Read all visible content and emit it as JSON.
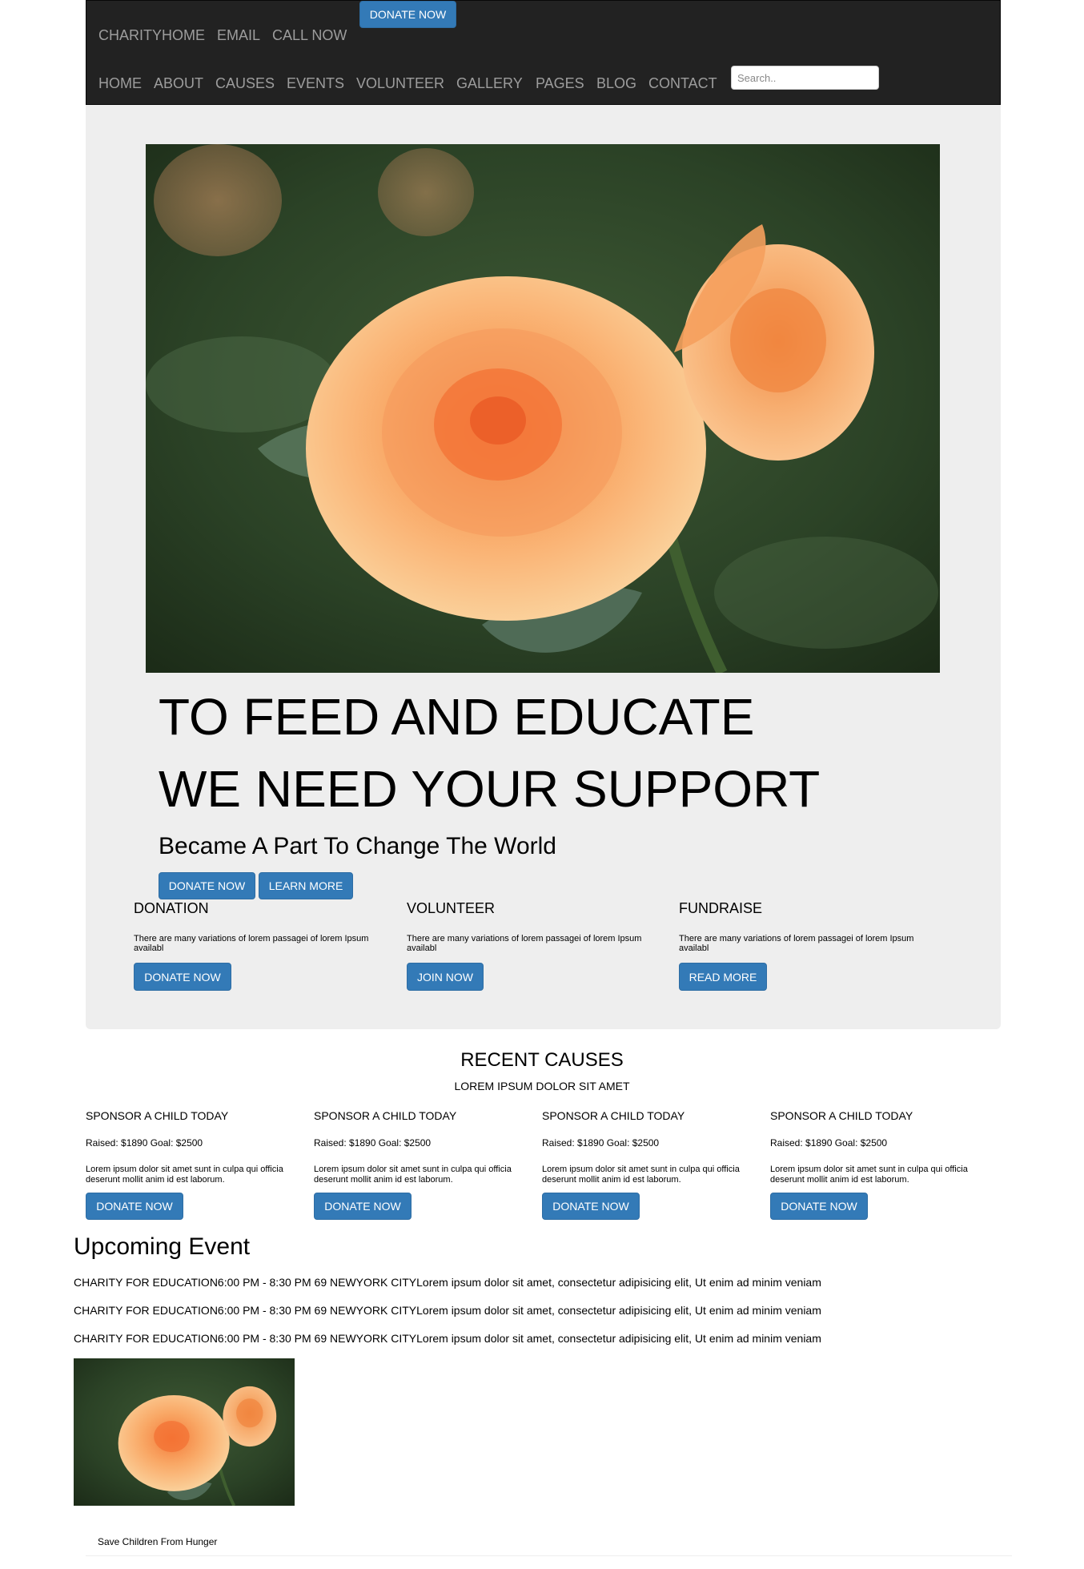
{
  "topbar": {
    "brand": "CHARITYHOME",
    "email": "EMAIL",
    "call": "CALL NOW",
    "donate_label": "DONATE NOW"
  },
  "nav": {
    "items": [
      "HOME",
      "ABOUT",
      "CAUSES",
      "EVENTS",
      "VOLUNTEER",
      "GALLERY",
      "PAGES",
      "BLOG",
      "CONTACT"
    ],
    "search_placeholder": "Search.."
  },
  "hero": {
    "line1": "TO FEED AND EDUCATE",
    "line2": "WE NEED YOUR SUPPORT",
    "subtitle": "Became A Part To Change The World",
    "donate_label": "DONATE NOW",
    "learn_label": "LEARN MORE"
  },
  "features": [
    {
      "title": "DONATION",
      "text": "There are many variations of lorem passagei of lorem Ipsum availabl",
      "button": "DONATE NOW"
    },
    {
      "title": "VOLUNTEER",
      "text": "There are many variations of lorem passagei of lorem Ipsum availabl",
      "button": "JOIN NOW"
    },
    {
      "title": "FUNDRAISE",
      "text": "There are many variations of lorem passagei of lorem Ipsum availabl",
      "button": "READ MORE"
    }
  ],
  "recent_causes": {
    "title": "RECENT CAUSES",
    "subtitle": "LOREM IPSUM DOLOR SIT AMET",
    "items": [
      {
        "title": "SPONSOR A CHILD TODAY",
        "raised": "Raised: $1890 Goal: $2500",
        "text": "Lorem ipsum dolor sit amet sunt in culpa qui officia deserunt mollit anim id est laborum.",
        "button": "DONATE NOW"
      },
      {
        "title": "SPONSOR A CHILD TODAY",
        "raised": "Raised: $1890 Goal: $2500",
        "text": "Lorem ipsum dolor sit amet sunt in culpa qui officia deserunt mollit anim id est laborum.",
        "button": "DONATE NOW"
      },
      {
        "title": "SPONSOR A CHILD TODAY",
        "raised": "Raised: $1890 Goal: $2500",
        "text": "Lorem ipsum dolor sit amet sunt in culpa qui officia deserunt mollit anim id est laborum.",
        "button": "DONATE NOW"
      },
      {
        "title": "SPONSOR A CHILD TODAY",
        "raised": "Raised: $1890 Goal: $2500",
        "text": "Lorem ipsum dolor sit amet sunt in culpa qui officia deserunt mollit anim id est laborum.",
        "button": "DONATE NOW"
      }
    ]
  },
  "events": {
    "title": "Upcoming Event",
    "lines": [
      "CHARITY FOR EDUCATION6:00 PM - 8:30 PM 69 NEWYORK CITYLorem ipsum dolor sit amet, consectetur adipisicing elit, Ut enim ad minim veniam",
      "CHARITY FOR EDUCATION6:00 PM - 8:30 PM 69 NEWYORK CITYLorem ipsum dolor sit amet, consectetur adipisicing elit, Ut enim ad minim veniam",
      "CHARITY FOR EDUCATION6:00 PM - 8:30 PM 69 NEWYORK CITYLorem ipsum dolor sit amet, consectetur adipisicing elit, Ut enim ad minim veniam"
    ]
  },
  "footer": {
    "caption": "Save Children From Hunger"
  },
  "colors": {
    "navbar_bg": "#222222",
    "nav_text": "#9d9d9d",
    "button_primary": "#337ab7",
    "jumbotron_bg": "#eeeeee"
  },
  "icons": {
    "hero_image": "rose-photo",
    "event_image": "rose-photo"
  }
}
